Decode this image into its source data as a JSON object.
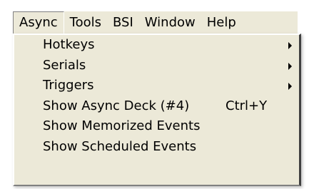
{
  "menubar": {
    "items": [
      {
        "label": "Async"
      },
      {
        "label": "Tools"
      },
      {
        "label": "BSI"
      },
      {
        "label": "Window"
      },
      {
        "label": "Help"
      }
    ]
  },
  "dropdown": {
    "items": [
      {
        "label": "Hotkeys",
        "icon": "submenu-arrow-icon"
      },
      {
        "label": "Serials",
        "icon": "submenu-arrow-icon"
      },
      {
        "label": "Triggers",
        "icon": "submenu-arrow-icon"
      },
      {
        "label": "Show Async Deck (#4)",
        "shortcut": "Ctrl+Y"
      },
      {
        "label": "Show Memorized Events"
      },
      {
        "label": "Show Scheduled Events"
      }
    ]
  }
}
